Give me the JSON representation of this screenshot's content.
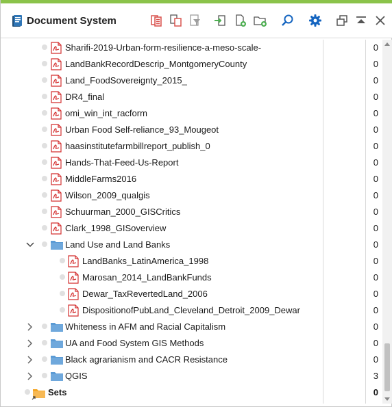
{
  "app": {
    "title": "Document System"
  },
  "toolbar": {
    "buttons": [
      {
        "name": "import-documents-icon",
        "color": "#d9534f"
      },
      {
        "name": "copy-documents-icon",
        "color": "#d9534f"
      },
      {
        "name": "filter-documents-icon",
        "color": "#9e9e9e"
      },
      {
        "name": "import-arrow-icon",
        "color": "#4caf50"
      },
      {
        "name": "new-document-icon",
        "color": "#4caf50"
      },
      {
        "name": "new-folder-icon",
        "color": "#4caf50"
      },
      {
        "name": "search-icon",
        "color": "#1565c0"
      },
      {
        "name": "gear-icon",
        "color": "#1565c0"
      },
      {
        "name": "undock-window-icon",
        "color": "#555555"
      },
      {
        "name": "maximize-icon",
        "color": "#555555"
      },
      {
        "name": "close-icon",
        "color": "#555555"
      }
    ]
  },
  "tree": {
    "rows": [
      {
        "type": "doc",
        "label": "Sharifi-2019-Urban-form-resilience-a-meso-scale-",
        "count": "0"
      },
      {
        "type": "doc",
        "label": "LandBankRecordDescrip_MontgomeryCounty",
        "count": "0"
      },
      {
        "type": "doc",
        "label": "Land_FoodSovereignty_2015_",
        "count": "0"
      },
      {
        "type": "doc",
        "label": "DR4_final",
        "count": "0"
      },
      {
        "type": "doc",
        "label": "omi_win_int_racform",
        "count": "0"
      },
      {
        "type": "doc",
        "label": "Urban Food Self-reliance_93_Mougeot",
        "count": "0"
      },
      {
        "type": "doc",
        "label": "haasinstitutefarmbillreport_publish_0",
        "count": "0"
      },
      {
        "type": "doc",
        "label": "Hands-That-Feed-Us-Report",
        "count": "0"
      },
      {
        "type": "doc",
        "label": "MiddleFarms2016",
        "count": "0"
      },
      {
        "type": "doc",
        "label": "Wilson_2009_qualgis",
        "count": "0"
      },
      {
        "type": "doc",
        "label": "Schuurman_2000_GISCritics",
        "count": "0"
      },
      {
        "type": "doc",
        "label": "Clark_1998_GISoverview",
        "count": "0"
      },
      {
        "type": "folder",
        "expanded": true,
        "label": "Land Use and Land Banks",
        "count": "0"
      },
      {
        "type": "subdoc",
        "label": "LandBanks_LatinAmerica_1998",
        "count": "0"
      },
      {
        "type": "subdoc",
        "label": "Marosan_2014_LandBankFunds",
        "count": "0"
      },
      {
        "type": "subdoc",
        "label": "Dewar_TaxRevertedLand_2006",
        "count": "0"
      },
      {
        "type": "subdoc",
        "label": "DispositionofPubLand_Cleveland_Detroit_2009_Dewar",
        "count": "0"
      },
      {
        "type": "folder",
        "expanded": false,
        "label": "Whiteness in AFM and Racial Capitalism",
        "count": "0"
      },
      {
        "type": "folder",
        "expanded": false,
        "label": "UA and Food System GIS Methods",
        "count": "0"
      },
      {
        "type": "folder",
        "expanded": false,
        "label": "Black agrarianism and CACR Resistance",
        "count": "0"
      },
      {
        "type": "folder",
        "expanded": false,
        "label": "QGIS",
        "count": "3"
      },
      {
        "type": "sets",
        "label": "Sets",
        "count": "0"
      }
    ]
  },
  "colors": {
    "accent": "#8bc34a",
    "pdf": "#d32f2f",
    "folder": "#5b9bd5",
    "sets": "#f5a623"
  }
}
